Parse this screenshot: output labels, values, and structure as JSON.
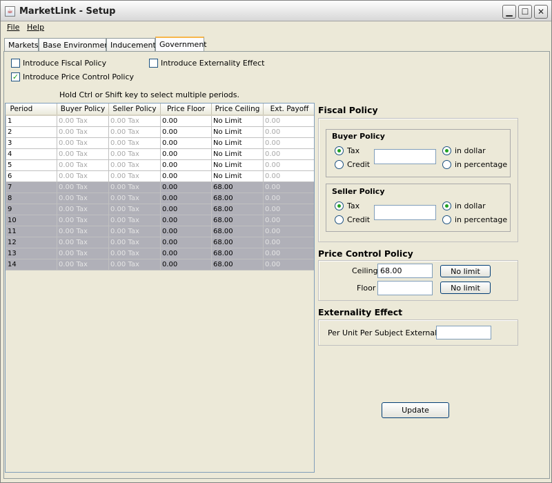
{
  "window": {
    "title": "MarketLink - Setup"
  },
  "menu": {
    "file": "File",
    "help": "Help"
  },
  "tabs": [
    "Markets",
    "Base Environment",
    "Inducements",
    "Government"
  ],
  "checks": {
    "fiscal": {
      "label": "Introduce Fiscal Policy",
      "checked": false
    },
    "price_control": {
      "label": "Introduce Price Control Policy",
      "checked": true
    },
    "externality": {
      "label": "Introduce Externality Effect",
      "checked": false
    }
  },
  "hint": "Hold Ctrl or Shift key to select multiple periods.",
  "table": {
    "columns": [
      "Period",
      "Buyer Policy",
      "Seller Policy",
      "Price Floor",
      "Price Ceiling",
      "Ext. Payoff"
    ],
    "rows": [
      [
        "1",
        "0.00 Tax",
        "0.00 Tax",
        "0.00",
        "No Limit",
        "0.00"
      ],
      [
        "2",
        "0.00 Tax",
        "0.00 Tax",
        "0.00",
        "No Limit",
        "0.00"
      ],
      [
        "3",
        "0.00 Tax",
        "0.00 Tax",
        "0.00",
        "No Limit",
        "0.00"
      ],
      [
        "4",
        "0.00 Tax",
        "0.00 Tax",
        "0.00",
        "No Limit",
        "0.00"
      ],
      [
        "5",
        "0.00 Tax",
        "0.00 Tax",
        "0.00",
        "No Limit",
        "0.00"
      ],
      [
        "6",
        "0.00 Tax",
        "0.00 Tax",
        "0.00",
        "No Limit",
        "0.00"
      ],
      [
        "7",
        "0.00 Tax",
        "0.00 Tax",
        "0.00",
        "68.00",
        "0.00"
      ],
      [
        "8",
        "0.00 Tax",
        "0.00 Tax",
        "0.00",
        "68.00",
        "0.00"
      ],
      [
        "9",
        "0.00 Tax",
        "0.00 Tax",
        "0.00",
        "68.00",
        "0.00"
      ],
      [
        "10",
        "0.00 Tax",
        "0.00 Tax",
        "0.00",
        "68.00",
        "0.00"
      ],
      [
        "11",
        "0.00 Tax",
        "0.00 Tax",
        "0.00",
        "68.00",
        "0.00"
      ],
      [
        "12",
        "0.00 Tax",
        "0.00 Tax",
        "0.00",
        "68.00",
        "0.00"
      ],
      [
        "13",
        "0.00 Tax",
        "0.00 Tax",
        "0.00",
        "68.00",
        "0.00"
      ],
      [
        "14",
        "0.00 Tax",
        "0.00 Tax",
        "0.00",
        "68.00",
        "0.00"
      ]
    ],
    "selected_rows": [
      7,
      8,
      9,
      10,
      11,
      12,
      13,
      14
    ]
  },
  "fiscal": {
    "title": "Fiscal Policy",
    "buyer": {
      "title": "Buyer Policy",
      "tax": "Tax",
      "credit": "Credit",
      "in_dollar": "in dollar",
      "in_percentage": "in percentage",
      "value": ""
    },
    "seller": {
      "title": "Seller Policy",
      "tax": "Tax",
      "credit": "Credit",
      "in_dollar": "in dollar",
      "in_percentage": "in percentage",
      "value": ""
    }
  },
  "price_control": {
    "title": "Price Control Policy",
    "ceiling_label": "Ceiling",
    "ceiling_value": "68.00",
    "floor_label": "Floor",
    "floor_value": "",
    "no_limit": "No limit"
  },
  "externality": {
    "title": "Externality Effect",
    "label": "Per Unit Per Subject Externality",
    "value": ""
  },
  "update_label": "Update",
  "colors": {
    "selected_row": "#b0b0b8",
    "check_mark": "#21a121",
    "tab_accent": "#f7b64a"
  }
}
